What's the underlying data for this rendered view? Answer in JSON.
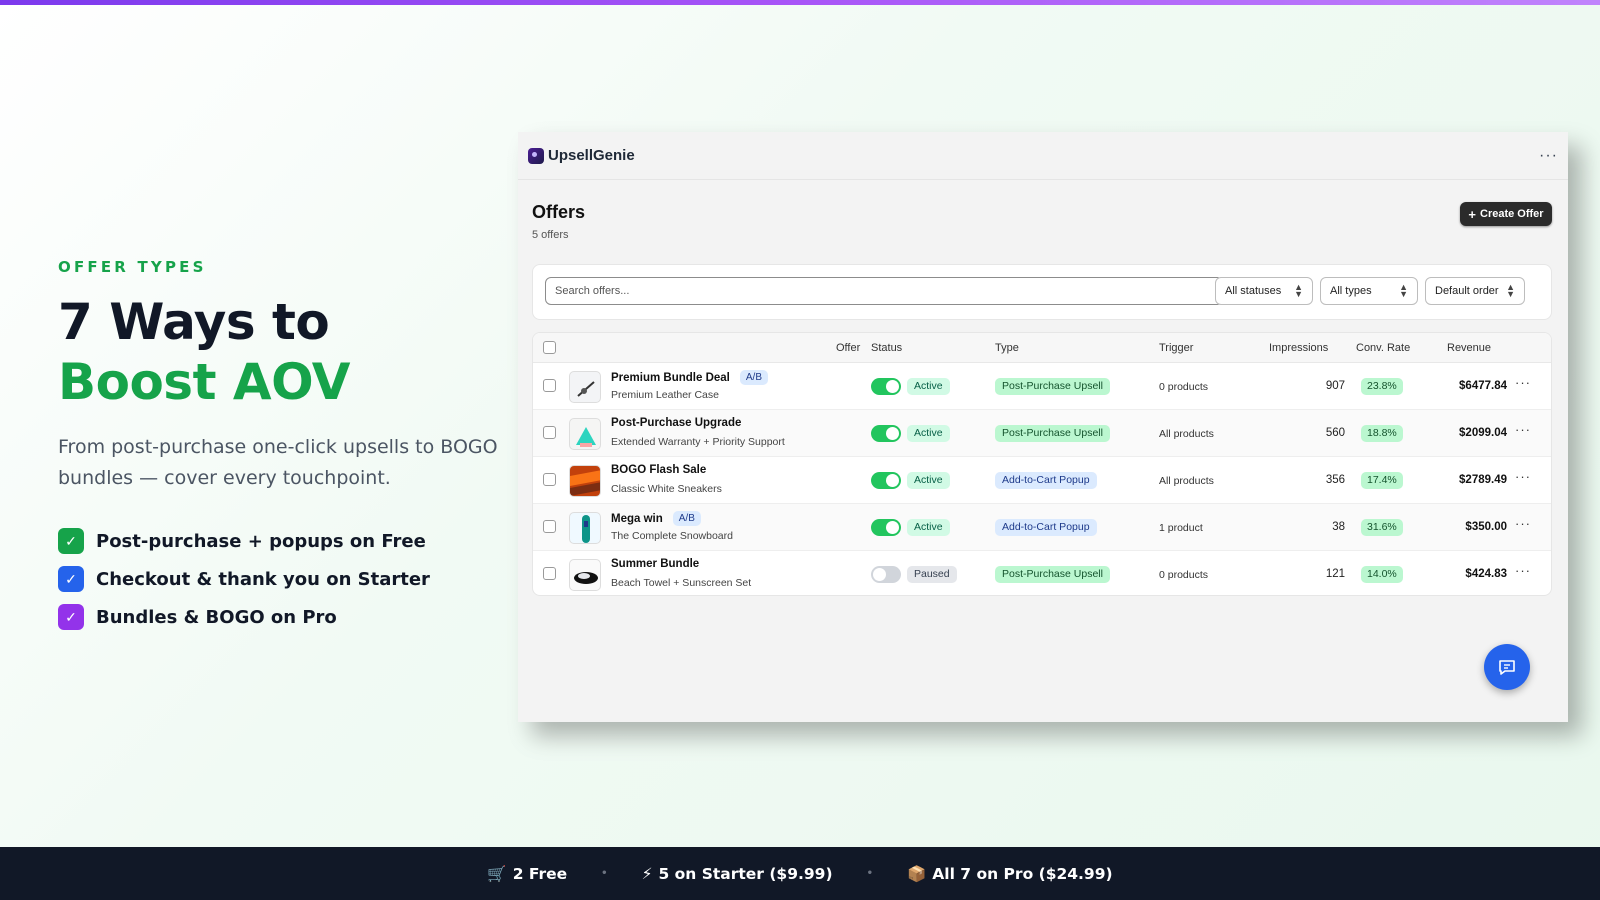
{
  "hero": {
    "eyebrow": "OFFER TYPES",
    "title_line1": "7 Ways to",
    "title_line2": "Boost AOV",
    "subtitle": "From post-purchase one-click upsells to BOGO bundles — cover every touchpoint.",
    "features": [
      {
        "text": "Post-purchase + popups on Free",
        "color": "#16a34a"
      },
      {
        "text": "Checkout & thank you on Starter",
        "color": "#2563eb"
      },
      {
        "text": "Bundles & BOGO on Pro",
        "color": "#9333ea"
      }
    ]
  },
  "app": {
    "name": "UpsellGenie",
    "menu": "···",
    "page_title": "Offers",
    "page_count": "5 offers",
    "create_button": "Create Offer",
    "search_placeholder": "Search offers...",
    "filters": {
      "status": "All statuses",
      "type": "All types",
      "order": "Default order"
    },
    "columns": {
      "offer": "Offer",
      "status": "Status",
      "type": "Type",
      "trigger": "Trigger",
      "impressions": "Impressions",
      "conv_rate": "Conv. Rate",
      "revenue": "Revenue"
    },
    "rows": [
      {
        "name": "Premium Bundle Deal",
        "ab": "A/B",
        "subtitle": "Premium Leather Case",
        "active": true,
        "status": "Active",
        "type": "Post-Purchase Upsell",
        "trigger": "0 products",
        "impressions": "907",
        "conv_rate": "23.8%",
        "revenue": "$6477.84",
        "menu": "···"
      },
      {
        "name": "Post-Purchase Upgrade",
        "ab": "",
        "subtitle": "Extended Warranty + Priority Support",
        "active": true,
        "status": "Active",
        "type": "Post-Purchase Upsell",
        "trigger": "All products",
        "impressions": "560",
        "conv_rate": "18.8%",
        "revenue": "$2099.04",
        "menu": "···"
      },
      {
        "name": "BOGO Flash Sale",
        "ab": "",
        "subtitle": "Classic White Sneakers",
        "active": true,
        "status": "Active",
        "type": "Add-to-Cart Popup",
        "trigger": "All products",
        "impressions": "356",
        "conv_rate": "17.4%",
        "revenue": "$2789.49",
        "menu": "···"
      },
      {
        "name": "Mega win",
        "ab": "A/B",
        "subtitle": "The Complete Snowboard",
        "active": true,
        "status": "Active",
        "type": "Add-to-Cart Popup",
        "trigger": "1 product",
        "impressions": "38",
        "conv_rate": "31.6%",
        "revenue": "$350.00",
        "menu": "···"
      },
      {
        "name": "Summer Bundle",
        "ab": "",
        "subtitle": "Beach Towel + Sunscreen Set",
        "active": false,
        "status": "Paused",
        "type": "Post-Purchase Upsell",
        "trigger": "0 products",
        "impressions": "121",
        "conv_rate": "14.0%",
        "revenue": "$424.83",
        "menu": "···"
      }
    ]
  },
  "bottom_bar": {
    "items": [
      {
        "icon": "🛒",
        "text": "2 Free"
      },
      {
        "icon": "⚡",
        "text": "5 on Starter ($9.99)"
      },
      {
        "icon": "📦",
        "text": "All 7 on Pro ($24.99)"
      }
    ],
    "separator": "•"
  },
  "colors": {
    "accent_green": "#16a34a",
    "toggle_on": "#22c55e",
    "toggle_off": "#d1d5db",
    "chat_blue": "#2563eb",
    "bottom_bar": "#111827"
  }
}
